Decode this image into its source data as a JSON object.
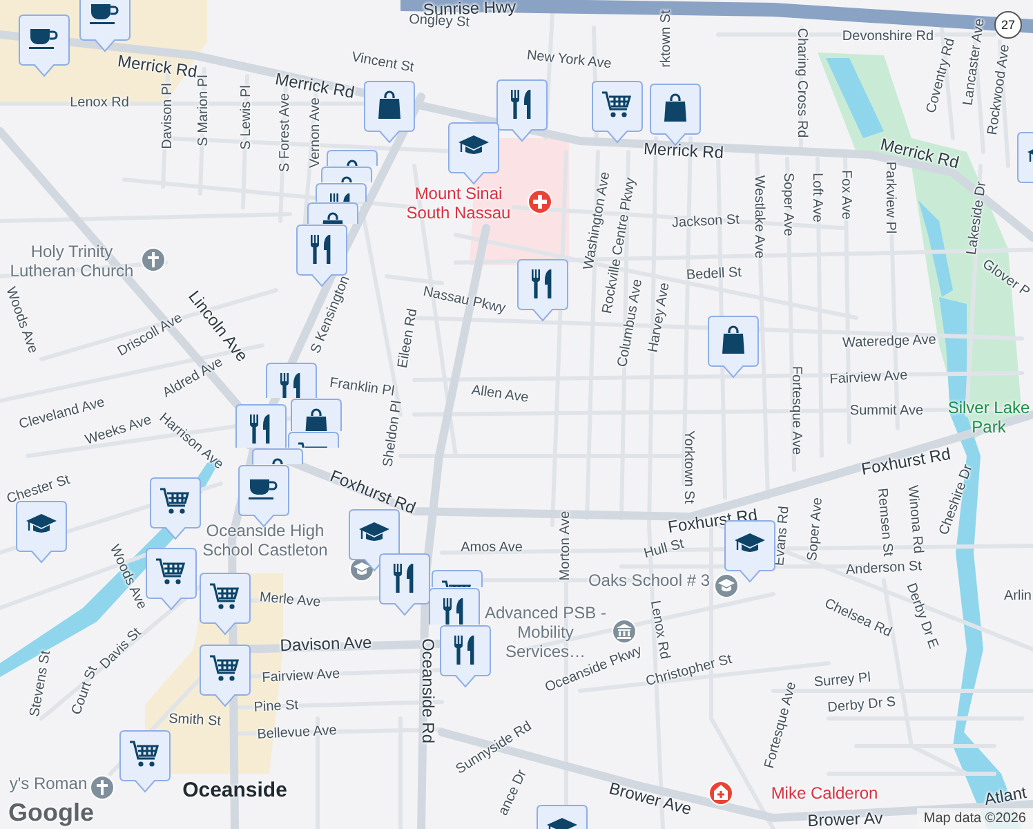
{
  "street_labels": [
    {
      "text": "Sunrise Hwy",
      "major": true
    },
    {
      "text": "Ongley St",
      "major": false
    },
    {
      "text": "Merrick Rd",
      "major": true
    },
    {
      "text": "Vincent St",
      "major": false
    },
    {
      "text": "Merrick Rd",
      "major": true
    },
    {
      "text": "Lenox Rd",
      "major": false
    },
    {
      "text": "Davison Pl",
      "major": false
    },
    {
      "text": "S Marion Pl",
      "major": false
    },
    {
      "text": "S Lewis Pl",
      "major": false
    },
    {
      "text": "S Forest Ave",
      "major": false
    },
    {
      "text": "Vernon Ave",
      "major": false
    },
    {
      "text": "New York Ave",
      "major": false
    },
    {
      "text": "Merrick Rd",
      "major": true
    },
    {
      "text": "Merrick Rd",
      "major": true
    },
    {
      "text": "Devonshire Rd",
      "major": false
    },
    {
      "text": "Charing Cross Rd",
      "major": false
    },
    {
      "text": "Coventry Rd",
      "major": false
    },
    {
      "text": "Lancaster Ave",
      "major": false
    },
    {
      "text": "Rockwood Ave",
      "major": false
    },
    {
      "text": "Washington Ave",
      "major": false
    },
    {
      "text": "Rockville Centre Pkwy",
      "major": false
    },
    {
      "text": "Jackson St",
      "major": false
    },
    {
      "text": "Westlake Ave",
      "major": false
    },
    {
      "text": "Soper Ave",
      "major": false
    },
    {
      "text": "Loft Ave",
      "major": false
    },
    {
      "text": "Fox Ave",
      "major": false
    },
    {
      "text": "Parkview Pl",
      "major": false
    },
    {
      "text": "Bedell St",
      "major": false
    },
    {
      "text": "Lakeside Dr",
      "major": false
    },
    {
      "text": "Glover P",
      "major": false
    },
    {
      "text": "Nassau Pkwy",
      "major": false
    },
    {
      "text": "Columbus Ave",
      "major": false
    },
    {
      "text": "Harvey Ave",
      "major": false
    },
    {
      "text": "Wateredge Ave",
      "major": false
    },
    {
      "text": "Fairview Ave",
      "major": false
    },
    {
      "text": "Summit Ave",
      "major": false
    },
    {
      "text": "Allen Ave",
      "major": false
    },
    {
      "text": "Franklin Pl",
      "major": false
    },
    {
      "text": "Eileen Rd",
      "major": false
    },
    {
      "text": "S Kensington",
      "major": false
    },
    {
      "text": "Lincoln Ave",
      "major": true
    },
    {
      "text": "Driscoll Ave",
      "major": false
    },
    {
      "text": "Woods Ave",
      "major": false
    },
    {
      "text": "Aldred Ave",
      "major": false
    },
    {
      "text": "Cleveland Ave",
      "major": false
    },
    {
      "text": "Weeks Ave",
      "major": false
    },
    {
      "text": "Harrison Ave",
      "major": false
    },
    {
      "text": "Foxhurst Rd",
      "major": true
    },
    {
      "text": "Sheldon Pl",
      "major": false
    },
    {
      "text": "Chester St",
      "major": false
    },
    {
      "text": "Fortesque Ave",
      "major": false
    },
    {
      "text": "Yorktown St",
      "major": false
    },
    {
      "text": "Foxhurst Rd",
      "major": true
    },
    {
      "text": "Foxhurst Rd",
      "major": true
    },
    {
      "text": "Evans Rd",
      "major": false
    },
    {
      "text": "Soper Ave",
      "major": false
    },
    {
      "text": "Remsen St",
      "major": false
    },
    {
      "text": "Winona Rd",
      "major": false
    },
    {
      "text": "Cheshire Dr",
      "major": false
    },
    {
      "text": "Amos Ave",
      "major": false
    },
    {
      "text": "Hull St",
      "major": false
    },
    {
      "text": "Anderson St",
      "major": false
    },
    {
      "text": "Merle Ave",
      "major": false
    },
    {
      "text": "Morton Ave",
      "major": false
    },
    {
      "text": "Chelsea Rd",
      "major": false
    },
    {
      "text": "Derby Dr E",
      "major": false
    },
    {
      "text": "Lenox Rd",
      "major": false
    },
    {
      "text": "Davison Ave",
      "major": true
    },
    {
      "text": "Fairview Ave",
      "major": false
    },
    {
      "text": "Christopher St",
      "major": false
    },
    {
      "text": "Oceanside Pkwy",
      "major": false
    },
    {
      "text": "Surrey Pl",
      "major": false
    },
    {
      "text": "Derby Dr S",
      "major": false
    },
    {
      "text": "Fortesque Ave",
      "major": false
    },
    {
      "text": "Pine St",
      "major": false
    },
    {
      "text": "Smith St",
      "major": false
    },
    {
      "text": "Bellevue Ave",
      "major": false
    },
    {
      "text": "Davis St",
      "major": false
    },
    {
      "text": "Woods Ave",
      "major": false
    },
    {
      "text": "Court St",
      "major": false
    },
    {
      "text": "Stevens St",
      "major": false
    },
    {
      "text": "Oceanside Rd",
      "major": true
    },
    {
      "text": "Sunnyside Rd",
      "major": false
    },
    {
      "text": "Brower Ave",
      "major": true
    },
    {
      "text": "Brower Av",
      "major": true
    },
    {
      "text": "Atlant",
      "major": true
    },
    {
      "text": "ance Dr",
      "major": false
    },
    {
      "text": "Arlin",
      "major": false
    },
    {
      "text": "rktown St",
      "major": false
    }
  ],
  "places": [
    {
      "text": "Mount Sinai South Nassau",
      "kind": "hospital"
    },
    {
      "text": "Holy Trinity Lutheran Church",
      "kind": "church"
    },
    {
      "text": "Silver Lake Park",
      "kind": "park"
    },
    {
      "text": "Oceanside High School Castleton",
      "kind": "school"
    },
    {
      "text": "Oaks School # 3",
      "kind": "school"
    },
    {
      "text": "Advanced PSB - Mobility Services…",
      "kind": "bank"
    },
    {
      "text": "Oceanside",
      "kind": "town"
    },
    {
      "text": "Mike Calderon",
      "kind": "clinic"
    },
    {
      "text": "y's Roman",
      "kind": "church"
    }
  ],
  "markers": [
    {
      "kind": "cafe"
    },
    {
      "kind": "cafe"
    },
    {
      "kind": "shop"
    },
    {
      "kind": "food"
    },
    {
      "kind": "school"
    },
    {
      "kind": "cart"
    },
    {
      "kind": "shop"
    },
    {
      "kind": "shop"
    },
    {
      "kind": "shop"
    },
    {
      "kind": "food"
    },
    {
      "kind": "shop"
    },
    {
      "kind": "food"
    },
    {
      "kind": "food"
    },
    {
      "kind": "school"
    },
    {
      "kind": "shop"
    },
    {
      "kind": "food"
    },
    {
      "kind": "shop"
    },
    {
      "kind": "food"
    },
    {
      "kind": "cart"
    },
    {
      "kind": "shop"
    },
    {
      "kind": "cafe"
    },
    {
      "kind": "cart"
    },
    {
      "kind": "school"
    },
    {
      "kind": "school"
    },
    {
      "kind": "cart"
    },
    {
      "kind": "cart"
    },
    {
      "kind": "food"
    },
    {
      "kind": "cart"
    },
    {
      "kind": "food"
    },
    {
      "kind": "food"
    },
    {
      "kind": "cart"
    },
    {
      "kind": "cart"
    },
    {
      "kind": "school"
    },
    {
      "kind": "school"
    }
  ],
  "route_shield": "27",
  "logo": "Google",
  "attribution": "Map data ©2026"
}
